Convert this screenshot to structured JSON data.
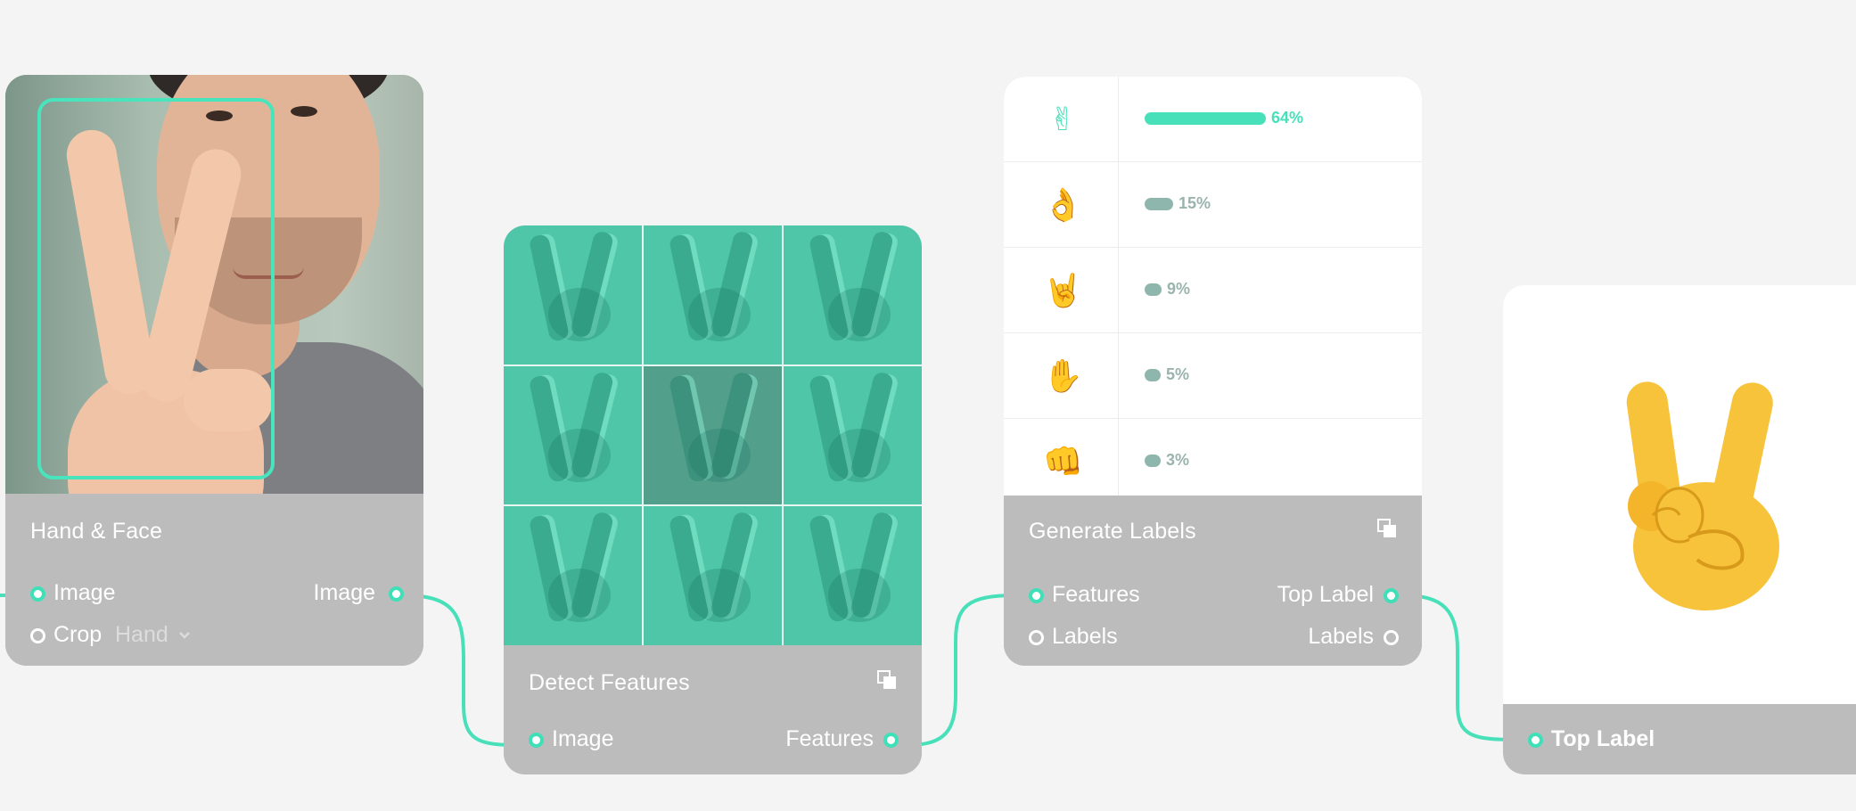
{
  "colors": {
    "accent": "#48e0b9",
    "node_footer": "#bcbcbc",
    "background": "#f4f4f4"
  },
  "nodes": {
    "hand_face": {
      "title": "Hand & Face",
      "inputs": [
        {
          "label": "Image",
          "port": "filled"
        },
        {
          "label": "Crop",
          "port": "hollow"
        }
      ],
      "crop_value": "Hand",
      "outputs": [
        {
          "label": "Image",
          "port": "filled"
        }
      ]
    },
    "detect_features": {
      "title": "Detect Features",
      "inputs": [
        {
          "label": "Image",
          "port": "filled"
        }
      ],
      "outputs": [
        {
          "label": "Features",
          "port": "filled"
        }
      ]
    },
    "generate_labels": {
      "title": "Generate Labels",
      "inputs": [
        {
          "label": "Features",
          "port": "filled"
        },
        {
          "label": "Labels",
          "port": "hollow"
        }
      ],
      "outputs": [
        {
          "label": "Top Label",
          "port": "filled"
        },
        {
          "label": "Labels",
          "port": "hollow"
        }
      ],
      "predictions": [
        {
          "gesture": "victory-hand-icon",
          "percent": 64,
          "label": "64%"
        },
        {
          "gesture": "ok-hand-icon",
          "percent": 15,
          "label": "15%"
        },
        {
          "gesture": "sign-of-horns-icon",
          "percent": 9,
          "label": "9%"
        },
        {
          "gesture": "raised-hand-icon",
          "percent": 5,
          "label": "5%"
        },
        {
          "gesture": "fist-icon",
          "percent": 3,
          "label": "3%"
        }
      ]
    },
    "output": {
      "inputs": [
        {
          "label": "Top Label",
          "port": "filled"
        }
      ],
      "result_icon": "victory-hand-emoji-icon"
    }
  }
}
